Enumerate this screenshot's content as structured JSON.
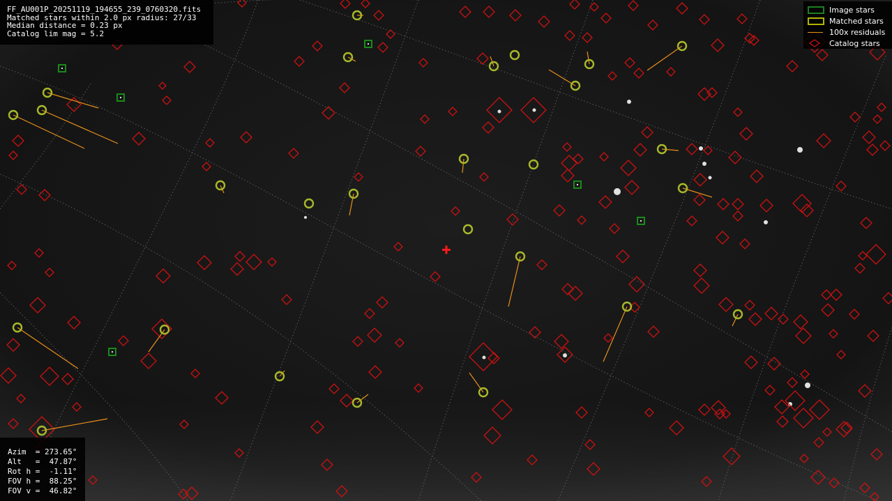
{
  "info": {
    "filename": "FF_AU001P_20251119_194655_239_0760320.fits",
    "matched": "Matched stars within 2.0 px radius: 27/33",
    "median": "Median distance = 0.23 px",
    "limmag": "Catalog lim mag = 5.2"
  },
  "pointing": {
    "azim": "Azim  = 273.65°",
    "alt": "Alt   =  47.87°",
    "rot": "Rot h =  -1.11°",
    "fovh": "FOV h =  88.25°",
    "fovv": "FOV v =  46.82°"
  },
  "legend": [
    {
      "label": "Image stars",
      "icon": "image-stars-icon",
      "color": "#1f7f1f"
    },
    {
      "label": "Matched stars",
      "icon": "matched-stars-icon",
      "color": "#b3b300"
    },
    {
      "label": "100x residuals",
      "icon": "residuals-icon",
      "color": "#e8901a"
    },
    {
      "label": "Catalog stars",
      "icon": "catalog-stars-icon",
      "color": "#cc1111"
    }
  ],
  "colors": {
    "catalog": "#cc1111",
    "matched": "#a8b82a",
    "image": "#1a8a1a",
    "residual": "#e8901a",
    "center": "#ff1a1a",
    "grid": "#6a6a6a"
  }
}
